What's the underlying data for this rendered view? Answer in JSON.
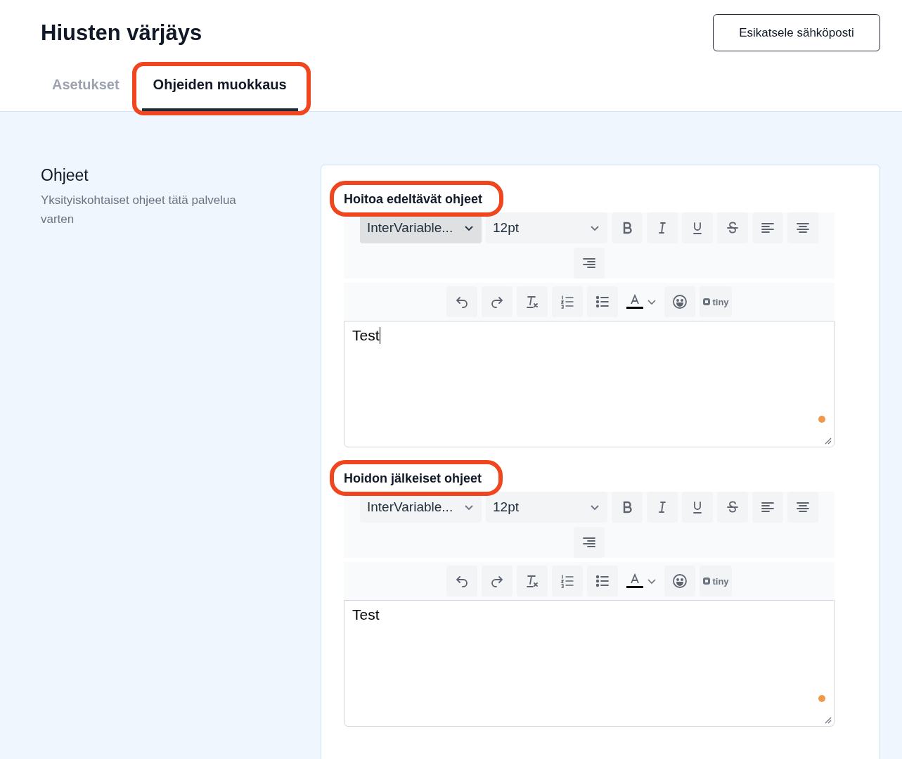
{
  "page": {
    "title": "Hiusten värjäys",
    "preview_button": "Esikatsele sähköposti"
  },
  "tabs": [
    {
      "label": "Asetukset",
      "selected": false,
      "highlighted": false
    },
    {
      "label": "Ohjeiden muokkaus",
      "selected": true,
      "highlighted": true
    }
  ],
  "section": {
    "title": "Ohjeet",
    "description": "Yksityiskohtaiset ohjeet tätä palvelua varten"
  },
  "editors": [
    {
      "label": "Hoitoa edeltävät ohjeet",
      "highlighted": true,
      "content": "Test",
      "focused": true,
      "toolbar": [
        {
          "kind": "select",
          "label": "InterVariable...",
          "active": true
        },
        {
          "kind": "select",
          "label": "12pt",
          "active": false
        },
        {
          "kind": "bold"
        },
        {
          "kind": "italic"
        },
        {
          "kind": "underline"
        },
        {
          "kind": "strike"
        },
        {
          "kind": "align-left"
        },
        {
          "kind": "align-center"
        },
        {
          "kind": "align-right"
        }
      ],
      "toolbar_2": [
        {
          "kind": "undo"
        },
        {
          "kind": "redo"
        },
        {
          "kind": "clear-format"
        },
        {
          "kind": "ordered-list"
        },
        {
          "kind": "bullet-list"
        },
        {
          "kind": "text-color"
        },
        {
          "kind": "emoji"
        },
        {
          "kind": "logo",
          "label": "tiny"
        }
      ]
    },
    {
      "label": "Hoidon jälkeiset ohjeet",
      "highlighted": true,
      "content": "Test",
      "focused": false,
      "toolbar": [
        {
          "kind": "select",
          "label": "InterVariable...",
          "active": false
        },
        {
          "kind": "select",
          "label": "12pt",
          "active": false
        },
        {
          "kind": "bold"
        },
        {
          "kind": "italic"
        },
        {
          "kind": "underline"
        },
        {
          "kind": "strike"
        },
        {
          "kind": "align-left"
        },
        {
          "kind": "align-center"
        },
        {
          "kind": "align-right"
        }
      ],
      "toolbar_2": [
        {
          "kind": "undo"
        },
        {
          "kind": "redo"
        },
        {
          "kind": "clear-format"
        },
        {
          "kind": "ordered-list"
        },
        {
          "kind": "bullet-list"
        },
        {
          "kind": "text-color"
        },
        {
          "kind": "emoji"
        },
        {
          "kind": "logo",
          "label": "tiny"
        }
      ]
    }
  ]
}
